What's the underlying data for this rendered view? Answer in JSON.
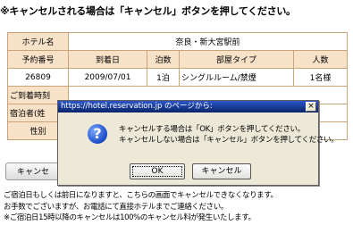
{
  "heading": "※キャンセルされる場合は「キャンセル」ボタンを押してください。",
  "hotel": {
    "label": "ホテル名",
    "value": "奈良・新大宮駅前"
  },
  "columns": [
    "予約番号",
    "到着日",
    "泊数",
    "部屋タイプ",
    "人数"
  ],
  "row": [
    "26809",
    "2009/07/01",
    "1泊",
    "シングルルーム/禁煙",
    "1名様"
  ],
  "partial_labels": [
    "ご到着時刻",
    "宿泊者(姓",
    "性別"
  ],
  "cancel_button": "キャンセ",
  "notes": [
    "ご宿泊日もしくは前日になりますと、こちらの画面でキャンセルできなくなります。",
    "お手数でございますが、お電話にて直接ホテルまでご連絡ください。",
    "※ご宿泊日15時以降のキャンセルは100%のキャンセル料が発生いたします。"
  ],
  "dialog": {
    "title": "https://hotel.reservation.jp のページから:",
    "close_glyph": "×",
    "icon_glyph": "?",
    "message_line1": "キャンセルする場合は「OK」ボタンを押してください。",
    "message_line2": "キャンセルしない場合は「キャンセル」ボタンを押してください。",
    "ok_label": "OK",
    "cancel_label": "キャンセル"
  }
}
